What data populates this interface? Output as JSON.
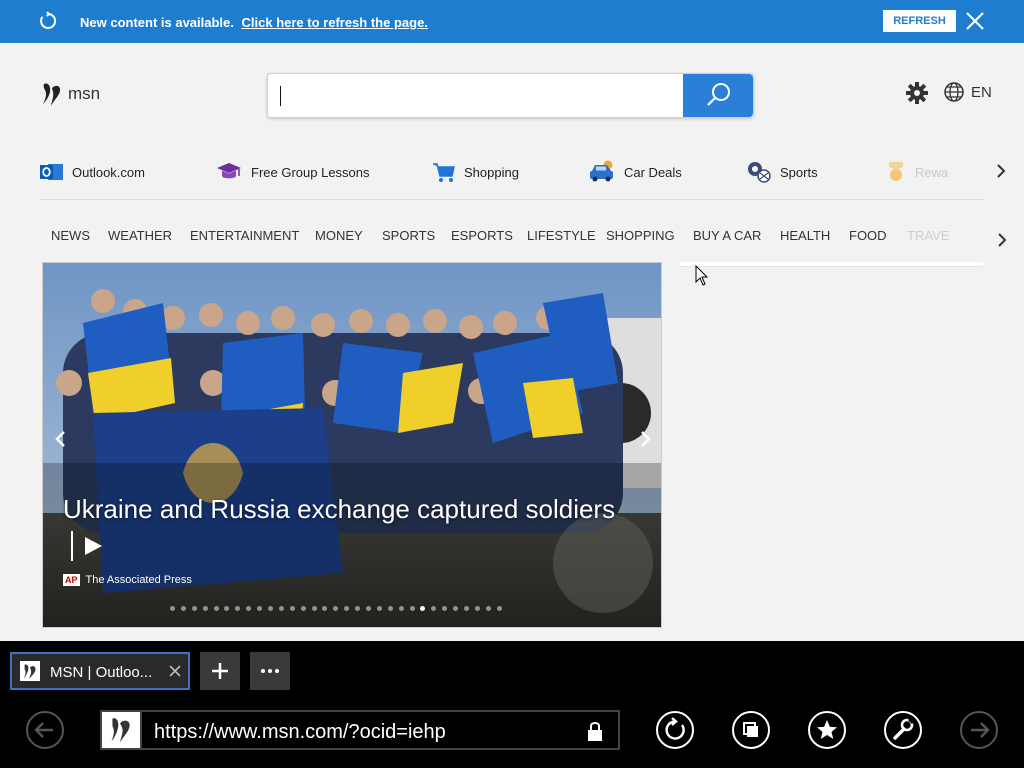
{
  "notification": {
    "message": "New content is available.",
    "link": "Click here to refresh the page.",
    "refresh_label": "REFRESH"
  },
  "header": {
    "logo": "msn",
    "search_value": "",
    "lang": "EN"
  },
  "quick_links": [
    {
      "label": "Outlook.com",
      "icon": "outlook-icon"
    },
    {
      "label": "Free Group Lessons",
      "icon": "graduation-cap-icon"
    },
    {
      "label": "Shopping",
      "icon": "shopping-cart-icon"
    },
    {
      "label": "Car Deals",
      "icon": "car-icon"
    },
    {
      "label": "Sports",
      "icon": "sports-ball-icon"
    },
    {
      "label": "Rewa",
      "icon": "rewards-medal-icon"
    }
  ],
  "categories": [
    "NEWS",
    "WEATHER",
    "ENTERTAINMENT",
    "MONEY",
    "SPORTS",
    "ESPORTS",
    "LIFESTYLE",
    "SHOPPING",
    "BUY A CAR",
    "HEALTH",
    "FOOD",
    "TRAVE"
  ],
  "hero": {
    "headline": "Ukraine and Russia exchange captured soldiers",
    "source": "The Associated Press",
    "source_logo": "AP",
    "slide_count": 31,
    "active_slide": 23
  },
  "browser": {
    "tab_title": "MSN | Outloo...",
    "url": "https://www.msn.com/?ocid=iehp"
  },
  "colors": {
    "brand_blue": "#1f7dd0",
    "search_button": "#2a80d8",
    "tab_border": "#3f70c8"
  }
}
